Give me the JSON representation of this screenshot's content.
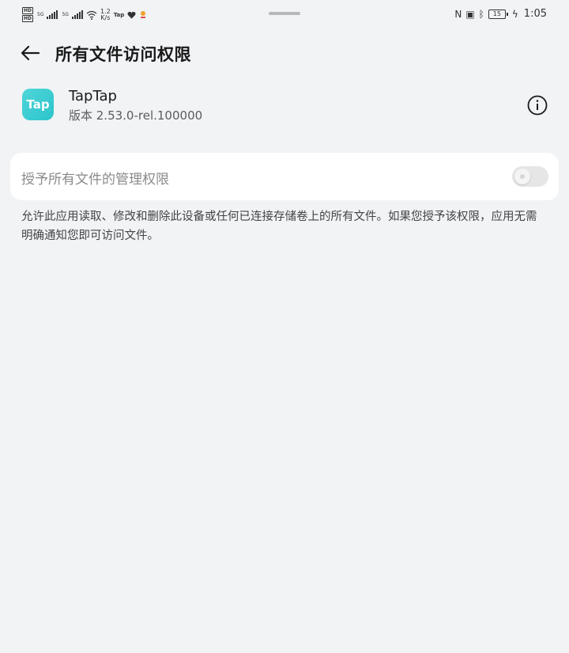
{
  "status_bar": {
    "network_type_1": "5G",
    "network_type_2": "5G",
    "speed_value": "1.2",
    "speed_unit": "K/s",
    "app_notification": "Tap",
    "battery": "15",
    "time": "1:05"
  },
  "header": {
    "title": "所有文件访问权限"
  },
  "app": {
    "icon_text": "Tap",
    "name": "TapTap",
    "version": "版本 2.53.0-rel.100000"
  },
  "permission": {
    "label": "授予所有文件的管理权限",
    "enabled": false
  },
  "description": "允许此应用读取、修改和删除此设备或任何已连接存储卷上的所有文件。如果您授予该权限，应用无需明确通知您即可访问文件。",
  "colors": {
    "background": "#f1f3f5",
    "card": "#ffffff",
    "app_icon": "#2cc4cc"
  }
}
